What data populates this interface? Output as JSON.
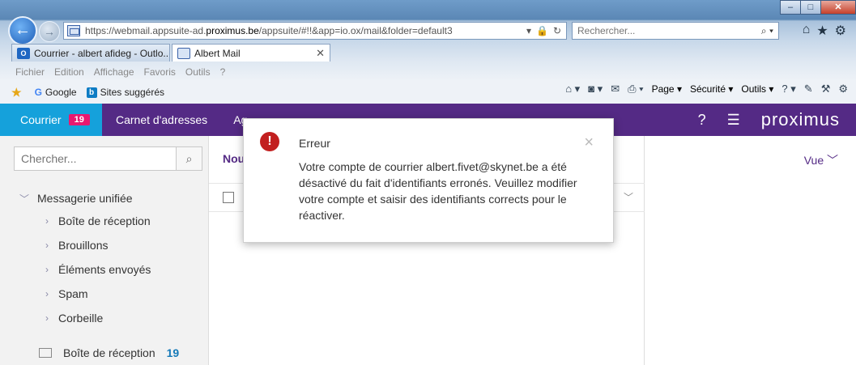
{
  "browser": {
    "url_prefix": "https://webmail.appsuite-ad.",
    "url_host": "proximus.be",
    "url_suffix": "/appsuite/#!!&app=io.ox/mail&folder=default3",
    "search_placeholder": "Rechercher...",
    "tabs": [
      {
        "label": "Courrier - albert afideg - Outlo...",
        "icon": "outlook-icon",
        "active": false
      },
      {
        "label": "Albert Mail",
        "icon": "mail-icon",
        "active": true
      }
    ],
    "menu": [
      "Fichier",
      "Edition",
      "Affichage",
      "Favoris",
      "Outils",
      "?"
    ],
    "favorites": [
      {
        "label": "Google",
        "icon": "google-icon"
      },
      {
        "label": "Sites suggérés",
        "icon": "bing-icon"
      }
    ],
    "commands": {
      "page": "Page",
      "security": "Sécurité",
      "tools": "Outils"
    },
    "window": {
      "minimize": "–",
      "maximize": "□",
      "close": "✕"
    }
  },
  "app": {
    "nav": {
      "mail_label": "Courrier",
      "mail_count": "19",
      "contacts_label": "Carnet d'adresses",
      "agenda_label": "Ag"
    },
    "logo": "proximus",
    "sidebar": {
      "search_placeholder": "Chercher...",
      "unified_label": "Messagerie unifiée",
      "folders": [
        "Boîte de réception",
        "Brouillons",
        "Éléments envoyés",
        "Spam",
        "Corbeille"
      ],
      "inbox_label": "Boîte de réception",
      "inbox_count": "19"
    },
    "list": {
      "new_label": "Nou"
    },
    "reading": {
      "view_label": "Vue"
    }
  },
  "dialog": {
    "title": "Erreur",
    "message": "Votre compte de courrier albert.fivet@skynet.be a été désactivé du fait d'identifiants erronés. Veuillez modifier votre compte et saisir des identifiants corrects pour le réactiver.",
    "close_symbol": "×"
  },
  "colors": {
    "app_purple": "#542a85",
    "mail_blue": "#15a1db",
    "badge_pink": "#e9186f",
    "error_red": "#c21f1f"
  }
}
